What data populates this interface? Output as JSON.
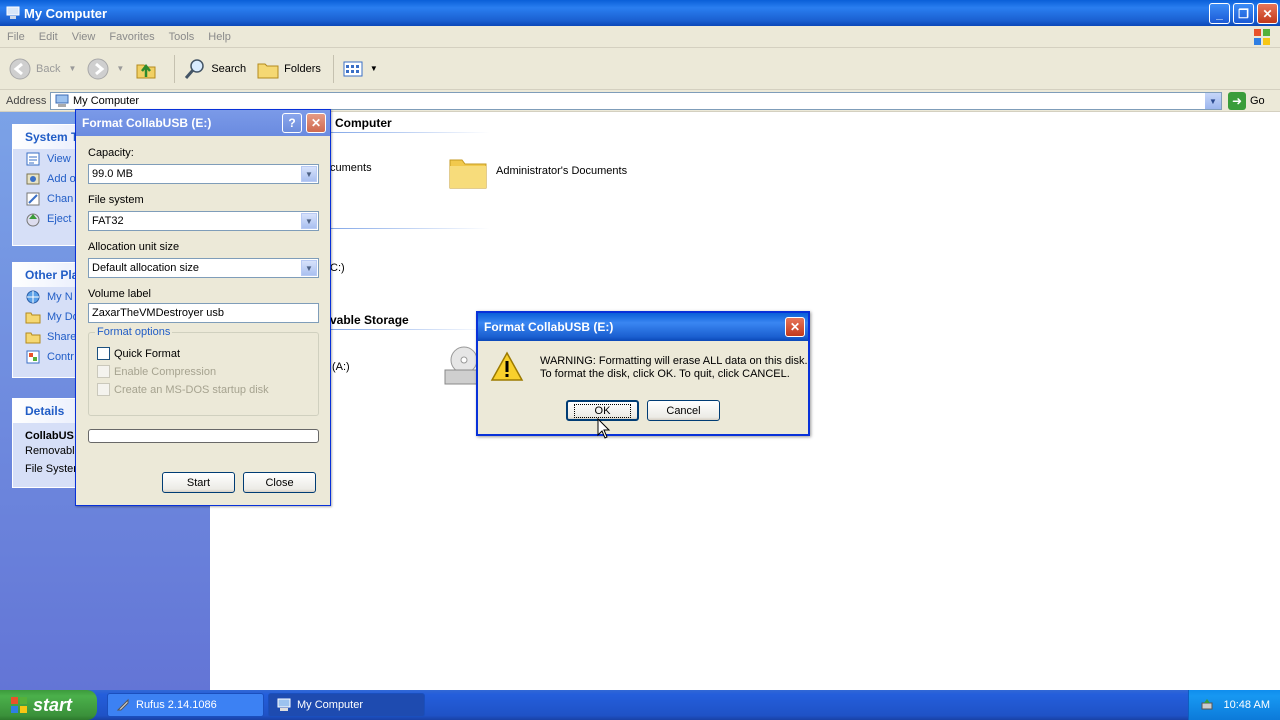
{
  "window": {
    "title": "My Computer",
    "menu": [
      "File",
      "Edit",
      "View",
      "Favorites",
      "Tools",
      "Help"
    ],
    "toolbar": {
      "back_label": "Back",
      "search_label": "Search",
      "folders_label": "Folders"
    },
    "address": {
      "label": "Address",
      "value": "My Computer",
      "go_label": "Go"
    }
  },
  "taskpane": {
    "system_tasks": {
      "header": "System T",
      "items": [
        "View",
        "Add o",
        "Chan",
        "Eject"
      ]
    },
    "other_places": {
      "header": "Other Pla",
      "items": [
        "My N",
        "My Do",
        "Share",
        "Contr"
      ]
    },
    "details": {
      "header": "Details",
      "name": "CollabUS",
      "type": "Removabl",
      "file_system": "File Syster"
    }
  },
  "content": {
    "sections": [
      {
        "header": "Computer",
        "items": [
          "cuments",
          "Administrator's Documents"
        ]
      },
      {
        "header": "",
        "items": [
          "C:)"
        ]
      },
      {
        "header": "vable Storage",
        "items": [
          "(A:)"
        ]
      }
    ]
  },
  "format_dialog": {
    "title": "Format CollabUSB (E:)",
    "capacity_label": "Capacity:",
    "capacity_value": "99.0 MB",
    "filesystem_label": "File system",
    "filesystem_value": "FAT32",
    "alloc_label": "Allocation unit size",
    "alloc_value": "Default allocation size",
    "volume_label": "Volume label",
    "volume_value": "ZaxarTheVMDestroyer usb",
    "options_legend": "Format options",
    "quick_format": "Quick Format",
    "enable_compression": "Enable Compression",
    "msdos_disk": "Create an MS-DOS startup disk",
    "progress": 0,
    "start_label": "Start",
    "close_label": "Close"
  },
  "warning_dialog": {
    "title": "Format CollabUSB (E:)",
    "line1": "WARNING: Formatting will erase ALL data on this disk.",
    "line2": "To format the disk, click OK. To quit, click CANCEL.",
    "ok_label": "OK",
    "cancel_label": "Cancel"
  },
  "taskbar": {
    "start_label": "start",
    "tasks": [
      "Rufus 2.14.1086",
      "My Computer"
    ],
    "clock": "10:48 AM"
  }
}
